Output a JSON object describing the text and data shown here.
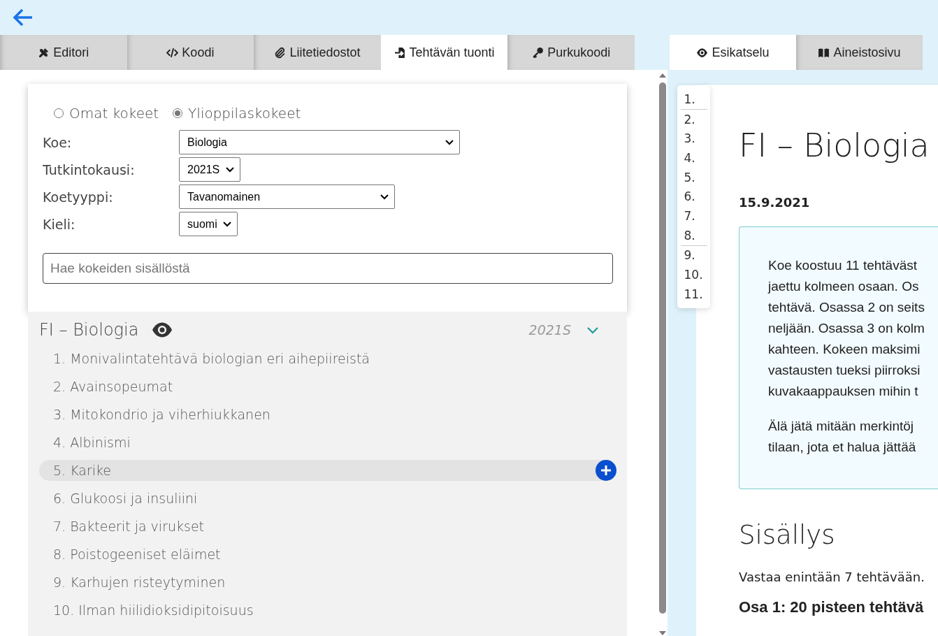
{
  "editor_tabs": [
    {
      "label": "Editori",
      "selected": false
    },
    {
      "label": "Koodi",
      "selected": false
    },
    {
      "label": "Liitetiedostot",
      "selected": false
    },
    {
      "label": "Tehtävän tuonti",
      "selected": true
    },
    {
      "label": "Purkukoodi",
      "selected": false
    }
  ],
  "import_form": {
    "sources": [
      {
        "label": "Omat kokeet",
        "selected": false
      },
      {
        "label": "Ylioppilaskokeet",
        "selected": true
      }
    ],
    "fields": [
      {
        "label": "Koe:",
        "value": "Biologia"
      },
      {
        "label": "Tutkintokausi:",
        "value": "2021S"
      },
      {
        "label": "Koetyyppi:",
        "value": "Tavanomainen"
      },
      {
        "label": "Kieli:",
        "value": "suomi"
      }
    ],
    "search": {
      "placeholder": "Hae kokeiden sisällöstä"
    }
  },
  "exam": {
    "title": "FI – Biologia",
    "period": "2021S",
    "expanded": true,
    "tasks": [
      {
        "label": "1. Monivalintatehtävä biologian eri aihepiireistä",
        "selected": false
      },
      {
        "label": "2. Avainsopeumat",
        "selected": false
      },
      {
        "label": "3. Mitokondrio ja viherhiukkanen",
        "selected": false
      },
      {
        "label": "4. Albinismi",
        "selected": false
      },
      {
        "label": "5. Karike",
        "selected": true
      },
      {
        "label": "6. Glukoosi ja insuliini",
        "selected": false
      },
      {
        "label": "7. Bakteerit ja virukset",
        "selected": false
      },
      {
        "label": "8. Poistogeeniset eläimet",
        "selected": false
      },
      {
        "label": "9. Karhujen risteytyminen",
        "selected": false
      },
      {
        "label": "10. Ilman hiilidioksidipitoisuus",
        "selected": false
      }
    ]
  },
  "preview_tabs": [
    {
      "label": "Esikatselu",
      "selected": true
    },
    {
      "label": "Aineistosivu",
      "selected": false
    }
  ],
  "preview": {
    "toc_groups": [
      [
        "1."
      ],
      [
        "2.",
        "3.",
        "4.",
        "5.",
        "6.",
        "7.",
        "8."
      ],
      [
        "9.",
        "10.",
        "11."
      ]
    ],
    "title": "FI – Biologia",
    "date": "15.9.2021",
    "instructions": [
      [
        "Koe koostuu 11 tehtäväst",
        "jaettu kolmeen osaan. Os",
        "tehtävä. Osassa 2 on seits",
        "neljään. Osassa 3 on kolm",
        "kahteen. Kokeen maksimi",
        "vastausten tueksi piirroksi",
        "kuvakaappauksen mihin t"
      ],
      [
        "Älä jätä mitään merkintöj",
        "tilaan, jota et halua jättää"
      ]
    ],
    "contents_heading": "Sisällys",
    "contents_text": "Vastaa enintään 7 tehtävään.",
    "part_heading": "Osa 1: 20 pisteen tehtävä"
  }
}
